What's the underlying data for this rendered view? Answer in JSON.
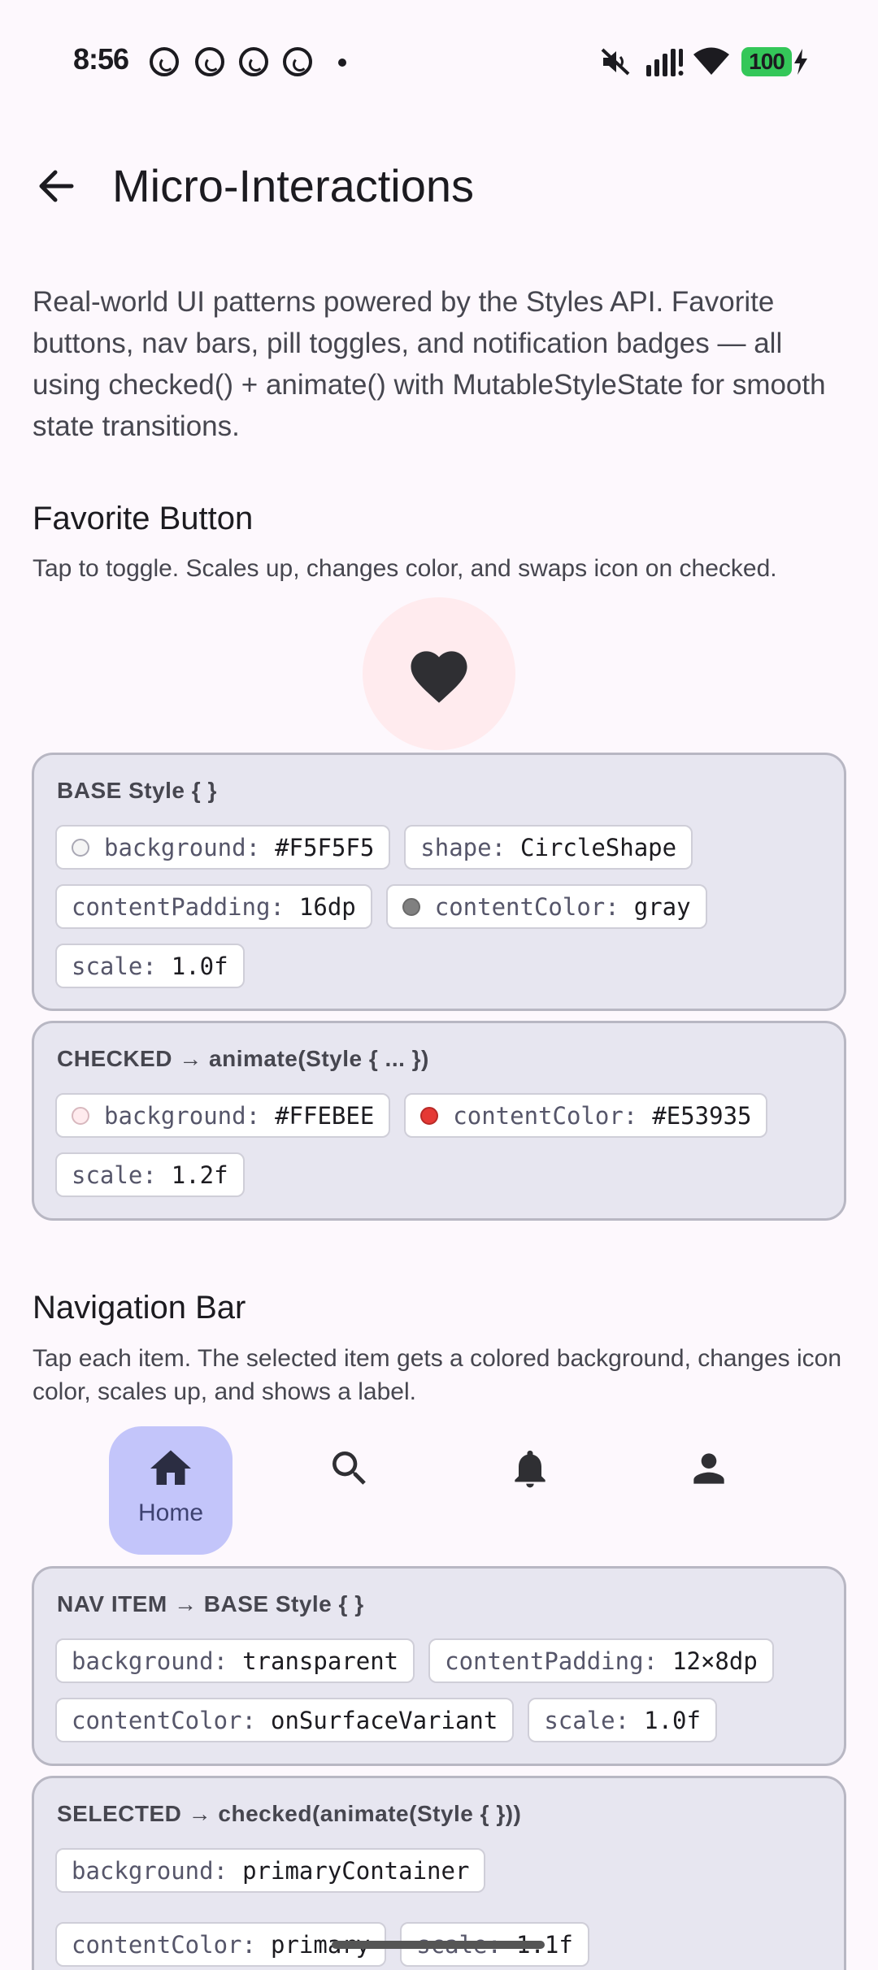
{
  "status_bar": {
    "time": "8:56",
    "battery": "100",
    "icons": [
      "whatsapp-icon",
      "whatsapp-icon",
      "whatsapp-icon",
      "whatsapp-icon",
      "notification-dot-icon",
      "mute-icon",
      "signal-icon",
      "wifi-icon",
      "battery-icon",
      "charging-bolt-icon"
    ]
  },
  "app_bar": {
    "title": "Micro-Interactions",
    "back_icon": "arrow-back-icon"
  },
  "intro": "Real-world UI patterns powered by the Styles API. Favorite buttons, nav bars, pill toggles, and notification badges — all using checked() + animate() with MutableStyleState for smooth state transitions.",
  "favorite": {
    "title": "Favorite Button",
    "description": "Tap to toggle. Scales up, changes color, and swaps icon on checked.",
    "icon": "heart-icon",
    "circle_color": "#FFEBEE",
    "base_card": {
      "title": "BASE Style { }",
      "chips": [
        {
          "key": "background:",
          "value": "#F5F5F5",
          "swatch": "#F5F5F5"
        },
        {
          "key": "shape:",
          "value": "CircleShape"
        },
        {
          "key": "contentPadding:",
          "value": "16dp"
        },
        {
          "key": "contentColor:",
          "value": "gray",
          "swatch": "#808080"
        },
        {
          "key": "scale:",
          "value": "1.0f"
        }
      ]
    },
    "checked_card": {
      "title": "CHECKED → animate(Style { ... })",
      "chips": [
        {
          "key": "background:",
          "value": "#FFEBEE",
          "swatch": "#FFEBEE"
        },
        {
          "key": "contentColor:",
          "value": "#E53935",
          "swatch": "#E53935"
        },
        {
          "key": "scale:",
          "value": "1.2f"
        }
      ]
    }
  },
  "navigation": {
    "title": "Navigation Bar",
    "description": "Tap each item. The selected item gets a colored background, changes icon color, scales up, and shows a label.",
    "items": [
      {
        "icon": "home-icon",
        "label": "Home",
        "selected": true
      },
      {
        "icon": "search-icon",
        "label": "",
        "selected": false
      },
      {
        "icon": "bell-icon",
        "label": "",
        "selected": false
      },
      {
        "icon": "person-icon",
        "label": "",
        "selected": false
      }
    ],
    "selected_color": "#C3C5FA",
    "item_card": {
      "title": "NAV ITEM → BASE Style { }",
      "chips": [
        {
          "key": "background:",
          "value": "transparent"
        },
        {
          "key": "contentPadding:",
          "value": "12×8dp"
        },
        {
          "key": "contentColor:",
          "value": "onSurfaceVariant"
        },
        {
          "key": "scale:",
          "value": "1.0f"
        }
      ]
    },
    "selected_card": {
      "title": "SELECTED → checked(animate(Style { }))",
      "chips": [
        {
          "key": "background:",
          "value": "primaryContainer"
        },
        {
          "key": "contentColor:",
          "value": "primary"
        },
        {
          "key": "scale:",
          "value": "1.1f"
        }
      ]
    }
  }
}
